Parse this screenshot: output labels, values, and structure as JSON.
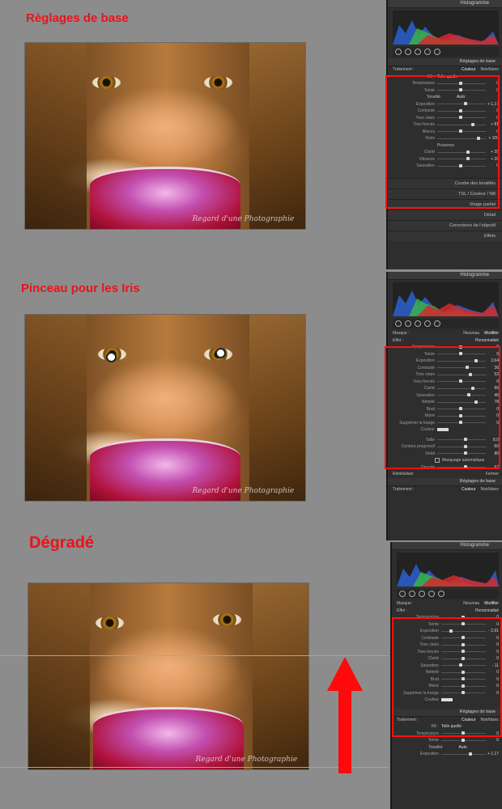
{
  "section1": {
    "heading": "Règlages de base"
  },
  "section2": {
    "heading": "Pinceau pour les Iris"
  },
  "section3": {
    "heading": "Dégradé"
  },
  "photo": {
    "signature": "Regard d'une Photographie"
  },
  "panel1": {
    "histogram_title": "Histogramme",
    "basic_title": "Réglages de base",
    "treatment_label": "Traitement :",
    "color_option": "Couleur",
    "bw_option": "Noir/blanc",
    "wb_label": "BB :",
    "wb_value": "Telle quelle",
    "tone_label": "Tonalité",
    "auto_label": "Auto",
    "presence_label": "Présence",
    "sliders": [
      {
        "label": "Température",
        "value": "0"
      },
      {
        "label": "Teinte",
        "value": "0"
      },
      {
        "label": "Exposition",
        "value": "+ 1,17"
      },
      {
        "label": "Contraste",
        "value": "0"
      },
      {
        "label": "Tons clairs",
        "value": "0"
      },
      {
        "label": "Tons foncés",
        "value": "+ 81"
      },
      {
        "label": "Blancs",
        "value": "0"
      },
      {
        "label": "Noirs",
        "value": "+ 100"
      },
      {
        "label": "Clarté",
        "value": "+ 39"
      },
      {
        "label": "Vibrance",
        "value": "+ 39"
      },
      {
        "label": "Saturation",
        "value": "0"
      }
    ],
    "slider_levels": [
      0.5,
      0.5,
      0.62,
      0.5,
      0.5,
      0.78,
      0.5,
      0.9,
      0.66,
      0.66,
      0.5
    ],
    "collapsed": [
      "Courbe des tonalités",
      "TSL / Couleur / NB",
      "Virage partiel",
      "Détail",
      "Corrections de l'objectif",
      "Effets"
    ]
  },
  "panel2": {
    "histogram_title": "Histogramme",
    "mask_label": "Masque :",
    "new_label": "Nouveau",
    "edit_label": "Modifier",
    "effect_label": "Effet :",
    "effect_value": "Personnalisé",
    "sliders": [
      {
        "label": "Température",
        "value": "0"
      },
      {
        "label": "Teinte",
        "value": "0"
      },
      {
        "label": "Exposition",
        "value": "2,64"
      },
      {
        "label": "Contraste",
        "value": "36"
      },
      {
        "label": "Tons clairs",
        "value": "52"
      },
      {
        "label": "Tons foncés",
        "value": "0"
      },
      {
        "label": "Clarté",
        "value": "66"
      },
      {
        "label": "Saturation",
        "value": "40"
      },
      {
        "label": "Netteté",
        "value": "78"
      },
      {
        "label": "Bruit",
        "value": "0"
      },
      {
        "label": "Moiré",
        "value": "0"
      },
      {
        "label": "Supprimer la frange",
        "value": "0"
      }
    ],
    "slider_levels": [
      0.5,
      0.5,
      0.85,
      0.64,
      0.72,
      0.5,
      0.78,
      0.68,
      0.85,
      0.5,
      0.5,
      0.5
    ],
    "color_label": "Couleur",
    "brush_rows": [
      {
        "label": "Taille",
        "value": "8,0"
      },
      {
        "label": "Contour progressif",
        "value": "60"
      },
      {
        "label": "Débit",
        "value": "80"
      },
      {
        "label": "Densité",
        "value": "67"
      }
    ],
    "auto_mask_label": "Masquage automatique",
    "reset_label": "Réinitialiser",
    "close_label": "Fermer",
    "basic_title": "Réglages de base",
    "treatment_label": "Traitement :",
    "color_option": "Couleur",
    "bw_option": "Noir/blanc"
  },
  "panel3": {
    "histogram_title": "Histogramme",
    "mask_label": "Masque :",
    "new_label": "Nouveau",
    "edit_label": "Modifier",
    "effect_label": "Effet :",
    "effect_value": "Personnalisé",
    "sliders": [
      {
        "label": "Température",
        "value": "0"
      },
      {
        "label": "Teinte",
        "value": "0"
      },
      {
        "label": "Exposition",
        "value": "- 2,91"
      },
      {
        "label": "Contraste",
        "value": "0"
      },
      {
        "label": "Tons clairs",
        "value": "0"
      },
      {
        "label": "Tons foncés",
        "value": "0"
      },
      {
        "label": "Clarté",
        "value": "0"
      },
      {
        "label": "Saturation",
        "value": "- 11"
      },
      {
        "label": "Netteté",
        "value": "0"
      },
      {
        "label": "Bruit",
        "value": "0"
      },
      {
        "label": "Moiré",
        "value": "0"
      },
      {
        "label": "Supprimer la frange",
        "value": "0"
      }
    ],
    "slider_levels": [
      0.5,
      0.5,
      0.2,
      0.5,
      0.5,
      0.5,
      0.5,
      0.44,
      0.5,
      0.5,
      0.5,
      0.5
    ],
    "color_label": "Couleur",
    "basic_title": "Réglages de base",
    "treatment_label": "Traitement :",
    "color_option": "Couleur",
    "bw_option": "Noir/blanc",
    "wb_label": "BB :",
    "wb_value": "Telle quelle",
    "sliders_basic": [
      {
        "label": "Température",
        "value": "0"
      },
      {
        "label": "Teinte",
        "value": "0"
      }
    ],
    "tone_label": "Tonalité",
    "auto_label": "Auto",
    "exposure_row": {
      "label": "Exposition",
      "value": "+ 1,17"
    }
  },
  "colors": {
    "heading_red": "#e8141c",
    "highlight_red": "#ff1010"
  }
}
